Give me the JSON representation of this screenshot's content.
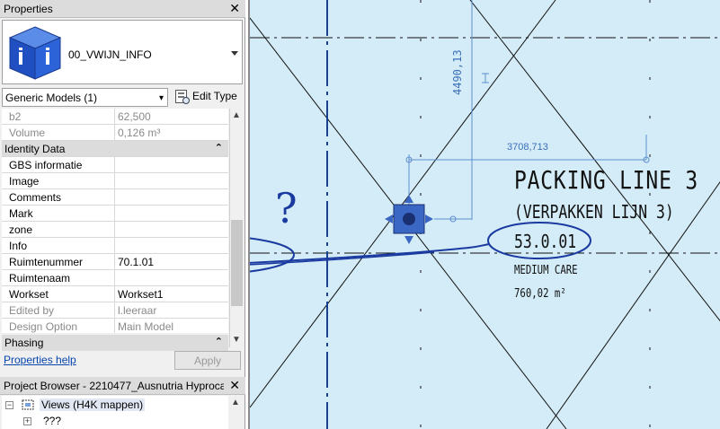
{
  "properties_panel": {
    "title": "Properties",
    "type_name": "00_VWIJN_INFO",
    "category": "Generic Models (1)",
    "edit_type_label": "Edit Type",
    "rows": [
      {
        "key": "b2",
        "value": "62,500",
        "greyed": true
      },
      {
        "key": "Volume",
        "value": "0,126 m³",
        "greyed": true
      },
      {
        "key": "Identity Data",
        "group": true
      },
      {
        "key": "GBS informatie",
        "value": ""
      },
      {
        "key": "Image",
        "value": ""
      },
      {
        "key": "Comments",
        "value": ""
      },
      {
        "key": "Mark",
        "value": ""
      },
      {
        "key": "zone",
        "value": ""
      },
      {
        "key": "Info",
        "value": ""
      },
      {
        "key": "Ruimtenummer",
        "value": "70.1.01"
      },
      {
        "key": "Ruimtenaam",
        "value": ""
      },
      {
        "key": "Workset",
        "value": "Workset1"
      },
      {
        "key": "Edited by",
        "value": "l.leeraar",
        "greyed": true
      },
      {
        "key": "Design Option",
        "value": "Main Model",
        "greyed": true
      }
    ],
    "phasing_group": "Phasing",
    "help_link": "Properties help",
    "apply_button": "Apply"
  },
  "project_browser": {
    "title": "Project Browser - 2210477_Ausnutria Hyproca ...",
    "nodes": [
      {
        "label": "Views (H4K mappen)"
      },
      {
        "label": "???"
      }
    ]
  },
  "drawing": {
    "dimension_vertical": "4490,13",
    "dimension_horizontal": "3708,713",
    "room_title": "PACKING LINE 3",
    "room_subtitle": "(VERPAKKEN LIJN 3)",
    "room_number": "53.0.01",
    "room_care": "MEDIUM CARE",
    "room_area": "760,02 m²",
    "question_mark": "?"
  },
  "colors": {
    "canvas_bg": "#d3ecf7",
    "annotation_ink": "#1a3aa0",
    "grid_line": "#1b3f8f",
    "dimension": "#5f8fd0"
  }
}
